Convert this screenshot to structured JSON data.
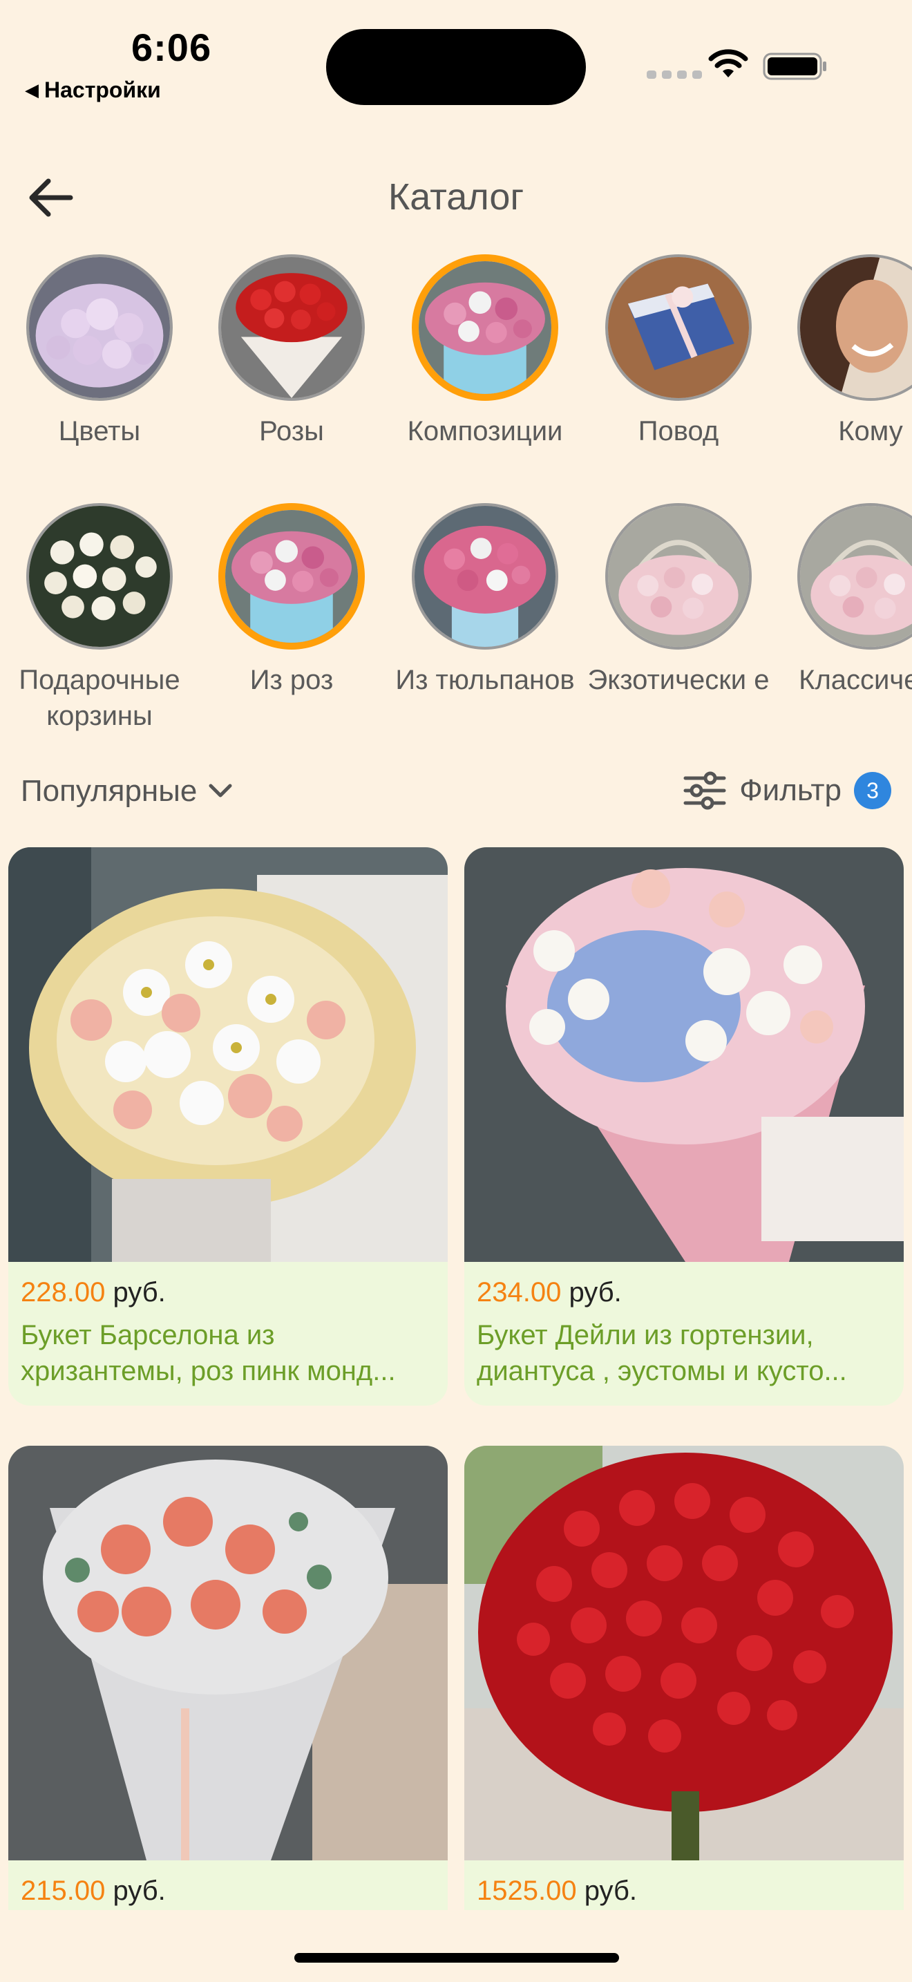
{
  "status_bar": {
    "time": "6:06",
    "back_app": "Настройки"
  },
  "header": {
    "title": "Каталог"
  },
  "categories_top": [
    {
      "label": "Цветы",
      "selected": false,
      "icon": "peony-bouquet-image"
    },
    {
      "label": "Розы",
      "selected": false,
      "icon": "red-roses-image"
    },
    {
      "label": "Композиции",
      "selected": true,
      "icon": "flower-box-image"
    },
    {
      "label": "Повод",
      "selected": false,
      "icon": "gift-box-image"
    },
    {
      "label": "Кому",
      "selected": false,
      "icon": "woman-portrait-image"
    }
  ],
  "categories_sub": [
    {
      "label": "Подарочные корзины",
      "selected": false,
      "icon": "white-roses-basket-image"
    },
    {
      "label": "Из роз",
      "selected": true,
      "icon": "rose-box-image"
    },
    {
      "label": "Из тюльпанов",
      "selected": false,
      "icon": "pink-tulips-image"
    },
    {
      "label": "Экзотически е",
      "selected": false,
      "icon": "flower-basket-image"
    },
    {
      "label": "Классиче е",
      "selected": false,
      "icon": "flower-basket-image"
    }
  ],
  "sort": {
    "label": "Популярные"
  },
  "filter": {
    "label": "Фильтр",
    "count": "3"
  },
  "products": [
    {
      "price": "228.00",
      "currency": "руб.",
      "name": "Букет Барселона из хризантемы, роз пинк монд...",
      "palette": "white-pink"
    },
    {
      "price": "234.00",
      "currency": "руб.",
      "name": "Букет Дейли из гортензии, диантуса , эустомы и кусто...",
      "palette": "blue-white"
    },
    {
      "price": "215.00",
      "currency": "руб.",
      "name": "",
      "palette": "coral"
    },
    {
      "price": "1525.00",
      "currency": "руб.",
      "name": "",
      "palette": "red"
    }
  ],
  "colors": {
    "background": "#fdf2e2",
    "accent": "#ff9f0a",
    "price": "#f58212",
    "product_name": "#6c9e28",
    "card": "#eef8dc",
    "badge": "#2f86de"
  }
}
